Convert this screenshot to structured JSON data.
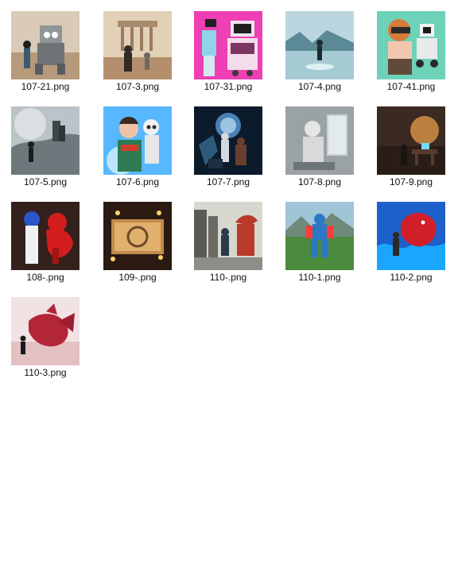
{
  "files": [
    {
      "name": "107-21.png",
      "icon": "thumbnail-robot-desert"
    },
    {
      "name": "107-3.png",
      "icon": "thumbnail-temple-robot"
    },
    {
      "name": "107-31.png",
      "icon": "thumbnail-vr-pink-robot"
    },
    {
      "name": "107-4.png",
      "icon": "thumbnail-lake-figure"
    },
    {
      "name": "107-41.png",
      "icon": "thumbnail-cartoon-vr"
    },
    {
      "name": "107-5.png",
      "icon": "thumbnail-storm-castle"
    },
    {
      "name": "107-6.png",
      "icon": "thumbnail-boy-robot"
    },
    {
      "name": "107-7.png",
      "icon": "thumbnail-scifi-face"
    },
    {
      "name": "107-8.png",
      "icon": "thumbnail-astronaut-window"
    },
    {
      "name": "107-9.png",
      "icon": "thumbnail-desk-sunset"
    },
    {
      "name": "108-.png",
      "icon": "thumbnail-girl-red-dragon"
    },
    {
      "name": "109-.png",
      "icon": "thumbnail-scroll-candles"
    },
    {
      "name": "110-.png",
      "icon": "thumbnail-dragon-robot-city"
    },
    {
      "name": "110-1.png",
      "icon": "thumbnail-robot-meadow"
    },
    {
      "name": "110-2.png",
      "icon": "thumbnail-dragon-waves"
    },
    {
      "name": "110-3.png",
      "icon": "thumbnail-red-dragon-desert"
    }
  ]
}
